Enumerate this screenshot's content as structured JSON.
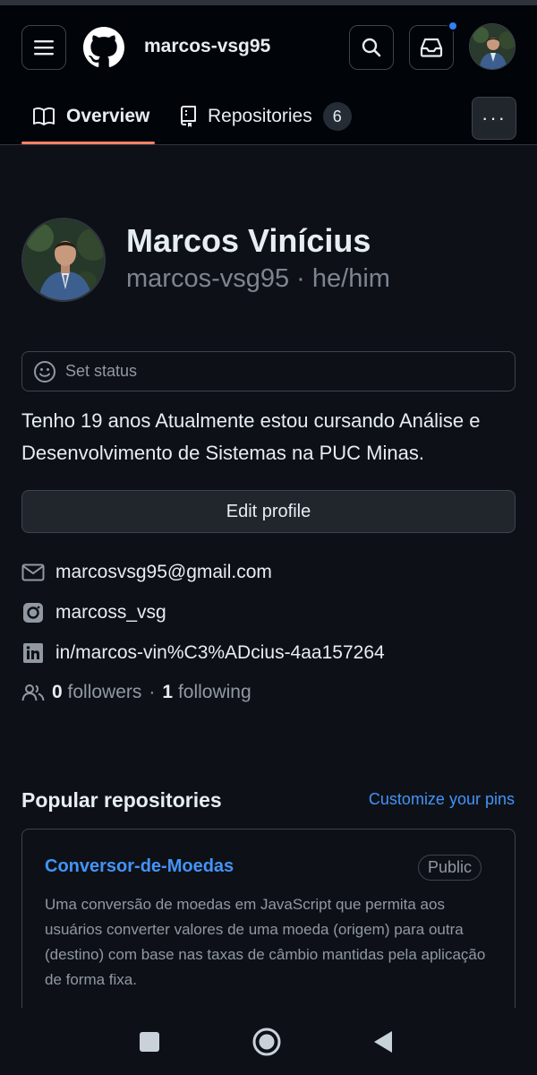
{
  "header": {
    "username": "marcos-vsg95",
    "tabs": [
      {
        "label": "Overview"
      },
      {
        "label": "Repositories",
        "count": "6"
      }
    ],
    "more_label": "···"
  },
  "profile": {
    "full_name": "Marcos Vinícius",
    "login_line": "marcos-vsg95 · he/him",
    "status_placeholder": "Set status",
    "bio": "Tenho 19 anos Atualmente estou cursando Análise e Desenvolvimento de Sistemas na PUC Minas.",
    "edit_label": "Edit profile",
    "email": "marcosvsg95@gmail.com",
    "instagram": "marcoss_vsg",
    "linkedin": "in/marcos-vin%C3%ADcius-4aa157264",
    "followers_count": "0",
    "followers_label": "followers",
    "separator": "·",
    "following_count": "1",
    "following_label": "following"
  },
  "popular": {
    "title": "Popular repositories",
    "customize_label": "Customize your pins",
    "repos": [
      {
        "name": "Conversor-de-Moedas",
        "visibility": "Public",
        "description": "Uma conversão de moedas em JavaScript que permita aos usuários converter valores de uma moeda (origem) para outra (destino) com base nas taxas de câmbio mantidas pela aplicação de forma fixa."
      }
    ]
  },
  "colors": {
    "background": "#0d1117",
    "header": "#010409",
    "accent_tab": "#f78166",
    "link": "#4493f8",
    "notification": "#2f81f7"
  },
  "icons": {
    "menu": "hamburger-icon",
    "logo": "github-logo",
    "search": "search-icon",
    "inbox": "inbox-icon",
    "overview": "book-icon",
    "repositories": "repo-icon",
    "status": "smiley-icon",
    "email": "mail-icon",
    "instagram": "instagram-icon",
    "linkedin": "linkedin-icon",
    "followers": "people-icon",
    "nav": [
      "square-icon",
      "circle-icon",
      "back-triangle-icon"
    ]
  }
}
